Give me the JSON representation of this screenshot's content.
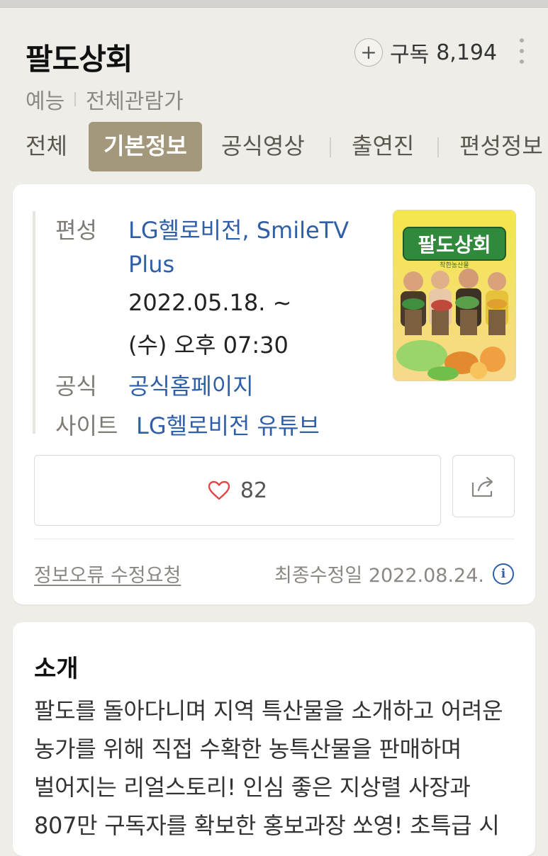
{
  "program": {
    "title": "팔도상회",
    "genre": "예능",
    "rating": "전체관람가"
  },
  "subscribe": {
    "label": "구독",
    "count": "8,194"
  },
  "tabs": [
    {
      "label": "전체",
      "active": false
    },
    {
      "label": "기본정보",
      "active": true
    },
    {
      "label": "공식영상",
      "active": false
    },
    {
      "label": "출연진",
      "active": false
    },
    {
      "label": "편성정보",
      "active": false
    }
  ],
  "info": {
    "broadcast_label": "편성",
    "channels": "LG헬로비전, SmileTV",
    "channels_cont": "Plus",
    "start_date": "2022.05.18. ~",
    "airtime": "(수) 오후 07:30",
    "official_label_1": "공식",
    "official_label_2": "사이트",
    "homepage_link": "공식홈페이지",
    "youtube_link": "LG헬로비전 유튜브"
  },
  "poster": {
    "title_text": "팔도상회",
    "subtitle_text": "착한농산물"
  },
  "actions": {
    "like_count": "82",
    "report_label": "정보오류 수정요청",
    "last_modified": "최종수정일 2022.08.24."
  },
  "intro": {
    "heading": "소개",
    "body": "팔도를 돌아다니며 지역 특산물을 소개하고 어려운 농가를 위해 직접 수확한 농특산물을 판매하며 벌어지는 리얼스토리! 인심 좋은 지상렬 사장과 807만 구독자를 확보한 홍보과장 쏘영! 초특급 시"
  },
  "colors": {
    "background": "#efede8",
    "active_tab": "#a3977c",
    "link": "#2f5fa8",
    "heart": "#e04848"
  },
  "icons": [
    "plus-icon",
    "more-vertical-icon",
    "heart-icon",
    "share-icon",
    "info-icon"
  ]
}
